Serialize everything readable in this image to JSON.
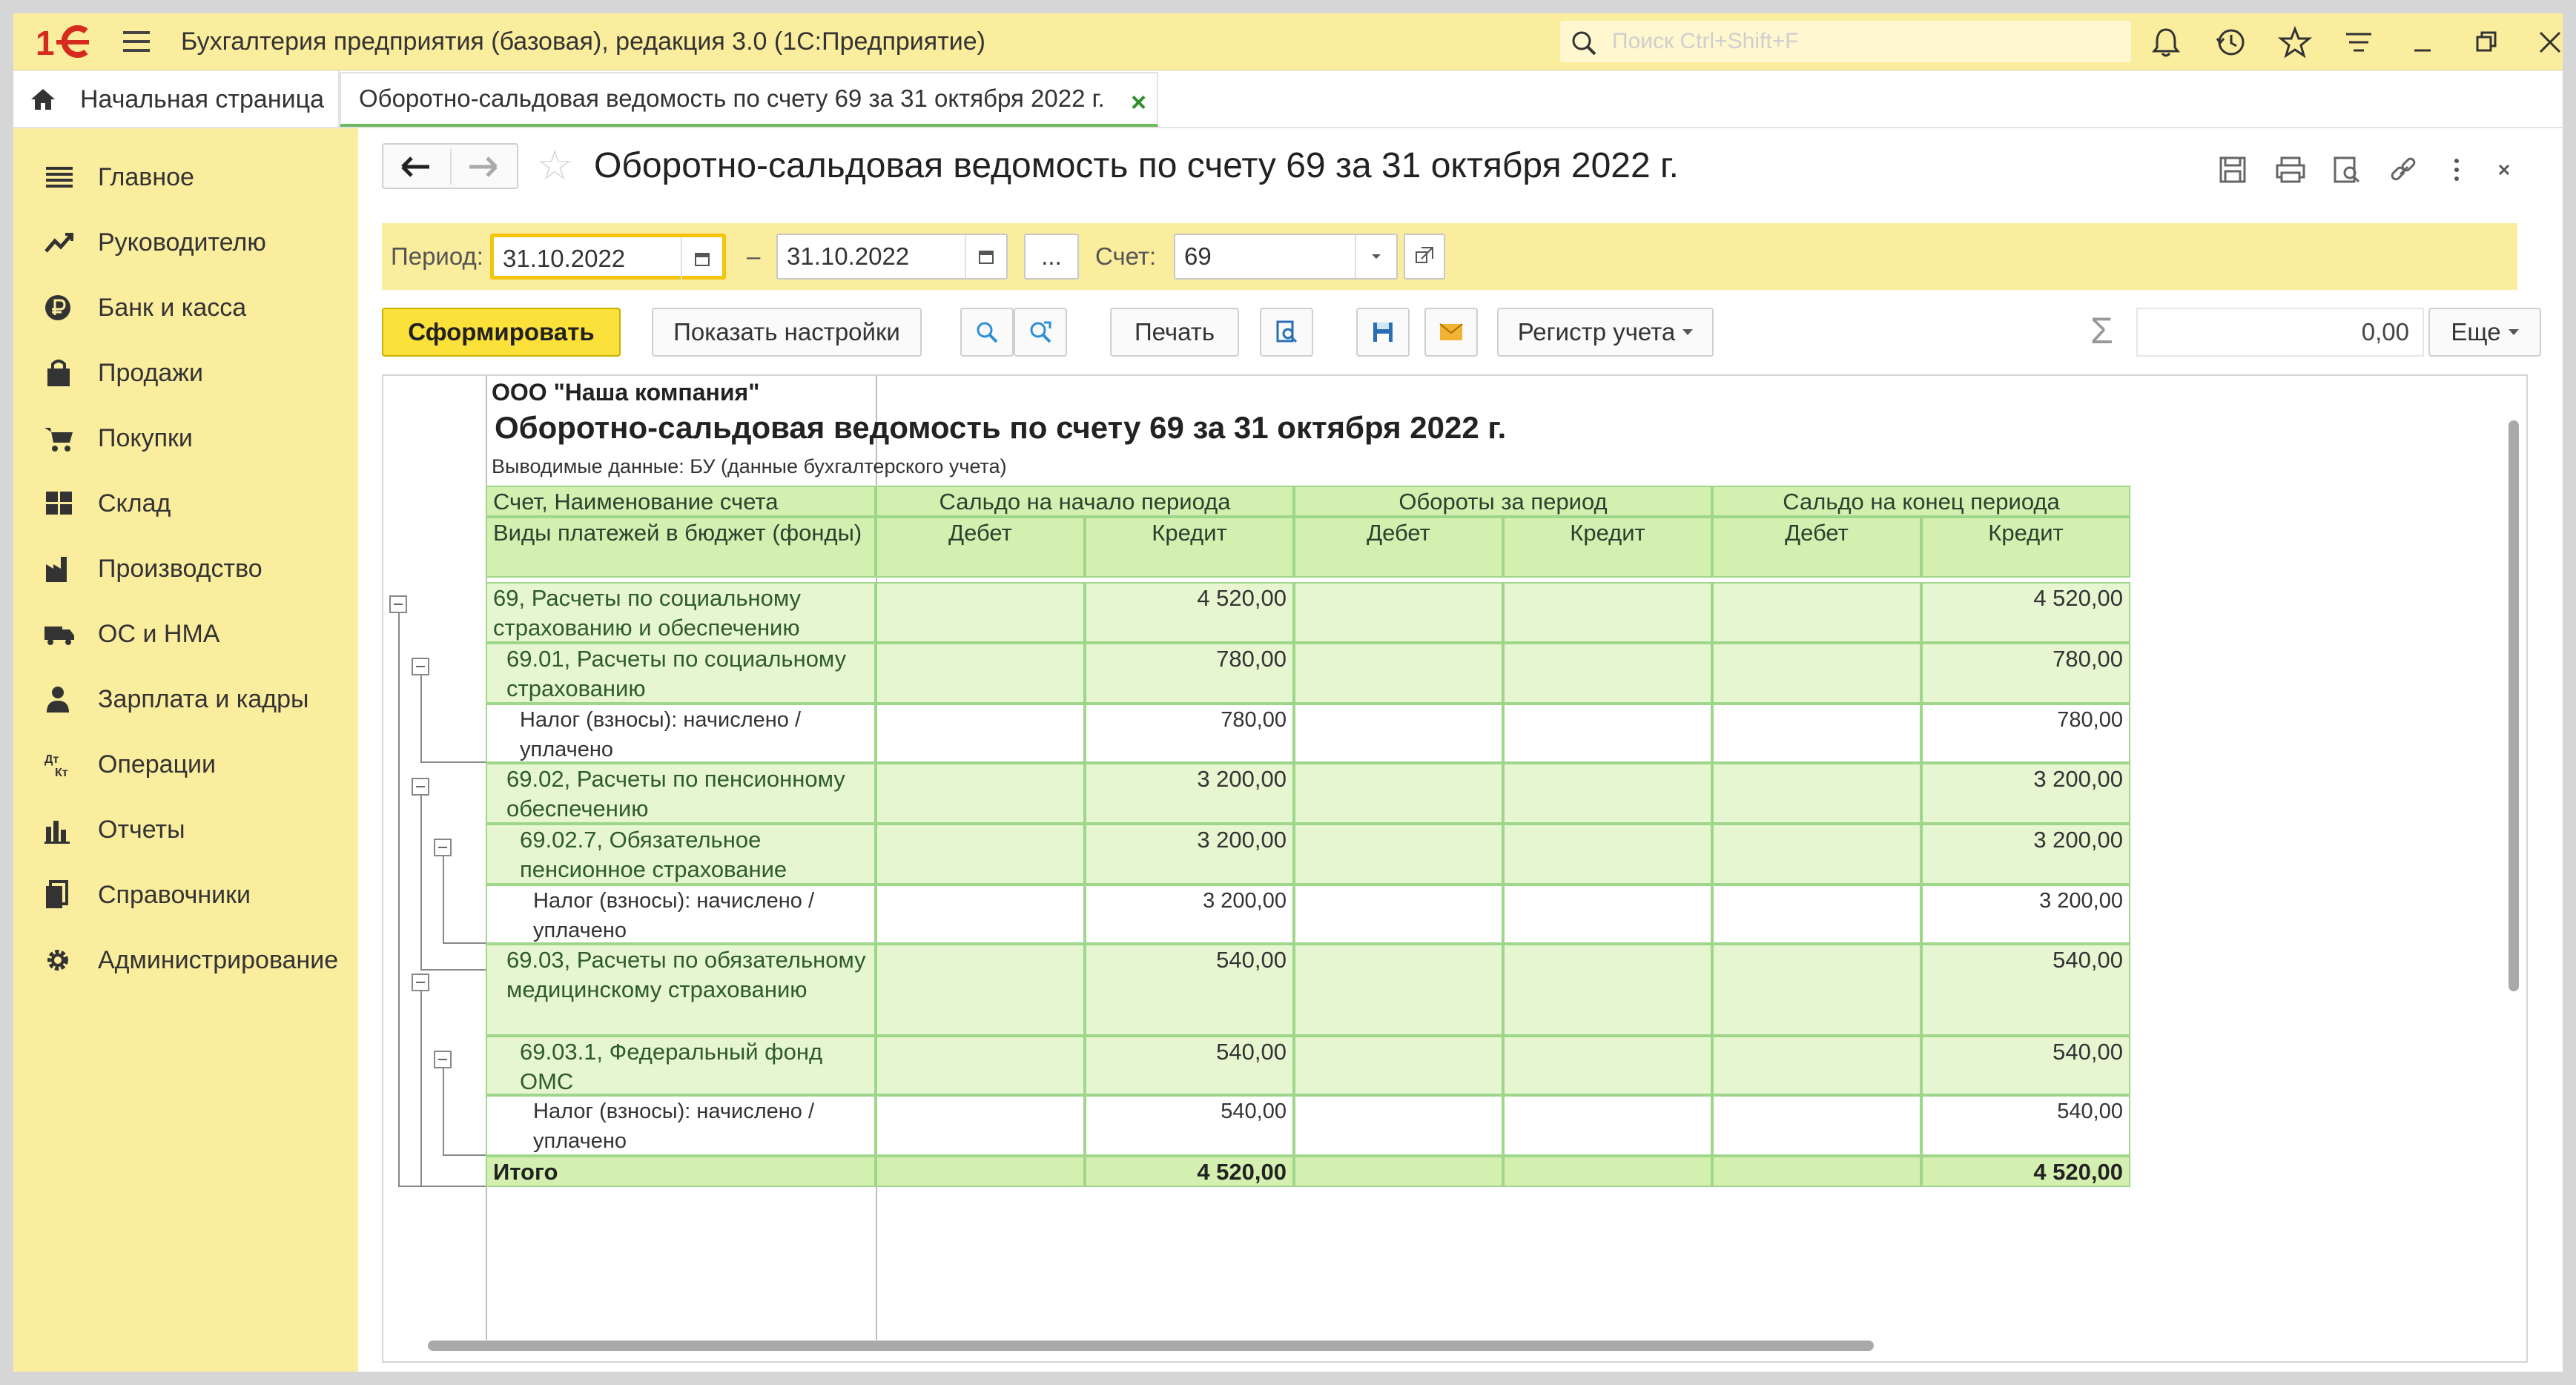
{
  "app": {
    "title": "Бухгалтерия предприятия (базовая), редакция 3.0  (1С:Предприятие)",
    "search_placeholder": "Поиск Ctrl+Shift+F"
  },
  "tabs": {
    "home": "Начальная страница",
    "active": "Оборотно-сальдовая ведомость по счету 69 за 31 октября 2022 г.",
    "close": "×"
  },
  "sidebar": {
    "items": [
      {
        "label": "Главное",
        "icon": "menu-icon"
      },
      {
        "label": "Руководителю",
        "icon": "trend-icon"
      },
      {
        "label": "Банк и касса",
        "icon": "ruble-icon"
      },
      {
        "label": "Продажи",
        "icon": "bag-icon"
      },
      {
        "label": "Покупки",
        "icon": "cart-icon"
      },
      {
        "label": "Склад",
        "icon": "warehouse-icon"
      },
      {
        "label": "Производство",
        "icon": "factory-icon"
      },
      {
        "label": "ОС и НМА",
        "icon": "truck-icon"
      },
      {
        "label": "Зарплата и кадры",
        "icon": "person-icon"
      },
      {
        "label": "Операции",
        "icon": "dt-kt-icon"
      },
      {
        "label": "Отчеты",
        "icon": "bar-chart-icon"
      },
      {
        "label": "Справочники",
        "icon": "books-icon"
      },
      {
        "label": "Администрирование",
        "icon": "gear-icon"
      }
    ]
  },
  "page": {
    "title": "Оборотно-сальдовая ведомость по счету 69 за 31 октября 2022 г."
  },
  "filters": {
    "period_label": "Период:",
    "date_from": "31.10.2022",
    "dash": "–",
    "date_to": "31.10.2022",
    "dots": "...",
    "account_label": "Счет:",
    "account": "69"
  },
  "toolbar": {
    "generate": "Сформировать",
    "show_settings": "Показать настройки",
    "print": "Печать",
    "register": "Регистр учета",
    "sum": "0,00",
    "more": "Еще"
  },
  "report": {
    "org": "ООО \"Наша компания\"",
    "title": "Оборотно-сальдовая ведомость по счету 69 за 31 октября 2022 г.",
    "subtitle": "Выводимые данные: БУ (данные бухгалтерского учета)",
    "headers": {
      "account": "Счет, Наименование счета",
      "payments": "Виды платежей в бюджет (фонды)",
      "start": "Сальдо на начало периода",
      "turnover": "Обороты за период",
      "end": "Сальдо на конец периода",
      "debit": "Дебет",
      "credit": "Кредит"
    },
    "rows": [
      {
        "name": "69, Расчеты по социальному страхованию и обеспечению",
        "start_debit": "",
        "start_credit": "4 520,00",
        "turn_debit": "",
        "turn_credit": "",
        "end_debit": "",
        "end_credit": "4 520,00"
      },
      {
        "name": "69.01, Расчеты по социальному страхованию",
        "start_debit": "",
        "start_credit": "780,00",
        "turn_debit": "",
        "turn_credit": "",
        "end_debit": "",
        "end_credit": "780,00"
      },
      {
        "name": "Налог (взносы): начислено / уплачено",
        "start_debit": "",
        "start_credit": "780,00",
        "turn_debit": "",
        "turn_credit": "",
        "end_debit": "",
        "end_credit": "780,00"
      },
      {
        "name": "69.02, Расчеты по пенсионному обеспечению",
        "start_debit": "",
        "start_credit": "3 200,00",
        "turn_debit": "",
        "turn_credit": "",
        "end_debit": "",
        "end_credit": "3 200,00"
      },
      {
        "name": "69.02.7, Обязательное пенсионное страхование",
        "start_debit": "",
        "start_credit": "3 200,00",
        "turn_debit": "",
        "turn_credit": "",
        "end_debit": "",
        "end_credit": "3 200,00"
      },
      {
        "name": "Налог (взносы): начислено / уплачено",
        "start_debit": "",
        "start_credit": "3 200,00",
        "turn_debit": "",
        "turn_credit": "",
        "end_debit": "",
        "end_credit": "3 200,00"
      },
      {
        "name": "69.03, Расчеты по обязательному медицинскому страхованию",
        "start_debit": "",
        "start_credit": "540,00",
        "turn_debit": "",
        "turn_credit": "",
        "end_debit": "",
        "end_credit": "540,00"
      },
      {
        "name": "69.03.1, Федеральный фонд ОМС",
        "start_debit": "",
        "start_credit": "540,00",
        "turn_debit": "",
        "turn_credit": "",
        "end_debit": "",
        "end_credit": "540,00"
      },
      {
        "name": "Налог (взносы): начислено / уплачено",
        "start_debit": "",
        "start_credit": "540,00",
        "turn_debit": "",
        "turn_credit": "",
        "end_debit": "",
        "end_credit": "540,00"
      }
    ],
    "total": {
      "name": "Итого",
      "start_debit": "",
      "start_credit": "4 520,00",
      "turn_debit": "",
      "turn_credit": "",
      "end_debit": "",
      "end_credit": "4 520,00"
    }
  },
  "colors": {
    "accent_yellow": "#fbed9e",
    "primary_button": "#fde13b",
    "table_green": "#e6f6d0",
    "header_green": "#d4f0b0",
    "tab_underline": "#6cb85c"
  }
}
